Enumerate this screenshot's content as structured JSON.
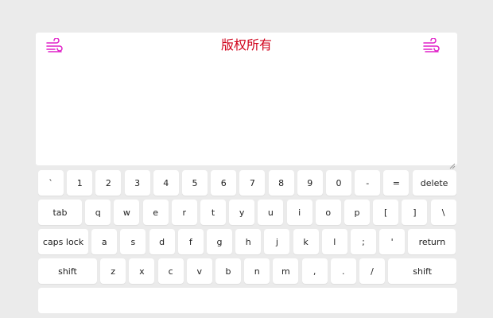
{
  "header": {
    "title": "版权所有",
    "title_color": "#d0021b",
    "left_icon": "wind-icon",
    "right_icon": "wind-icon",
    "icon_color": "#e020c8"
  },
  "keyboard": {
    "rows": [
      [
        "`",
        "1",
        "2",
        "3",
        "4",
        "5",
        "6",
        "7",
        "8",
        "9",
        "0",
        "-",
        "=",
        "delete"
      ],
      [
        "tab",
        "q",
        "w",
        "e",
        "r",
        "t",
        "y",
        "u",
        "i",
        "o",
        "p",
        "[",
        "]",
        "\\"
      ],
      [
        "caps lock",
        "a",
        "s",
        "d",
        "f",
        "g",
        "h",
        "j",
        "k",
        "l",
        ";",
        "'",
        "return"
      ],
      [
        "shift",
        "z",
        "x",
        "c",
        "v",
        "b",
        "n",
        "m",
        ",",
        ".",
        "/",
        "shift"
      ]
    ],
    "space_label": ""
  }
}
